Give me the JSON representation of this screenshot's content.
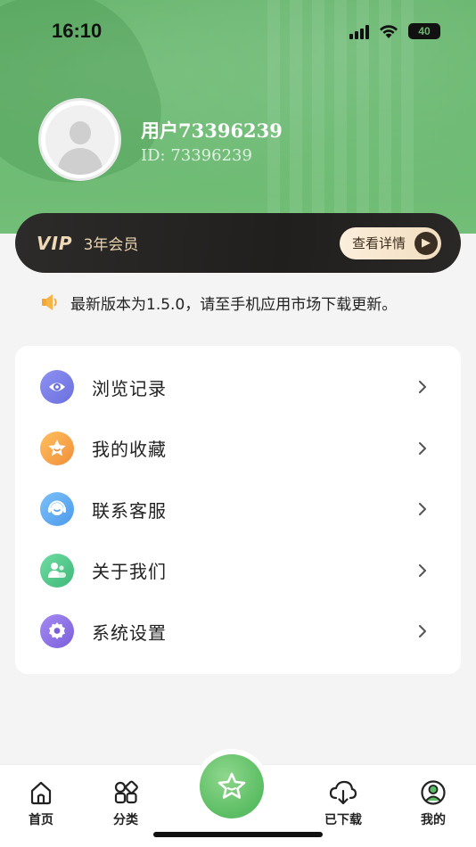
{
  "status_bar": {
    "time": "16:10",
    "battery": "40"
  },
  "profile": {
    "name": "用户73396239",
    "id_text": "ID: 73396239"
  },
  "vip": {
    "logo": "VIP",
    "level": "3年会员",
    "detail_label": "查看详情"
  },
  "notice": {
    "text": "最新版本为1.5.0，请至手机应用市场下载更新。",
    "icon": "speaker-icon"
  },
  "menu": {
    "items": [
      {
        "label": "浏览记录",
        "icon": "eye-icon",
        "color": "#7b7fe6"
      },
      {
        "label": "我的收藏",
        "icon": "star-icon",
        "color": "#f5a34a"
      },
      {
        "label": "联系客服",
        "icon": "headset-icon",
        "color": "#5aa8f0"
      },
      {
        "label": "关于我们",
        "icon": "people-icon",
        "color": "#52c98a"
      },
      {
        "label": "系统设置",
        "icon": "gear-icon",
        "color": "#8c6fe6"
      }
    ]
  },
  "tabs": [
    {
      "label": "首页",
      "icon": "home-icon",
      "active": false
    },
    {
      "label": "分类",
      "icon": "category-icon",
      "active": false
    },
    {
      "label": "",
      "icon": "star-icon",
      "active": false
    },
    {
      "label": "已下载",
      "icon": "download-cloud-icon",
      "active": false
    },
    {
      "label": "我的",
      "icon": "profile-icon",
      "active": true
    }
  ],
  "colors": {
    "brand_green": "#66b66c",
    "vip_dark": "#262422",
    "vip_gold": "#f0d9b5"
  }
}
